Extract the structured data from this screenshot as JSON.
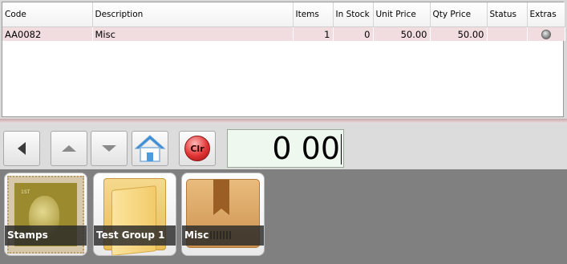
{
  "table": {
    "columns": [
      "Code",
      "Description",
      "Items",
      "In Stock",
      "Unit Price",
      "Qty Price",
      "Status",
      "Extras"
    ],
    "rows": [
      {
        "code": "AA0082",
        "description": "Misc",
        "items": "1",
        "in_stock": "0",
        "unit_price": "50.00",
        "qty_price": "50.00",
        "status": "",
        "extras_icon": "gear-icon"
      }
    ]
  },
  "toolbar": {
    "back_icon": "left-arrow-icon",
    "up_icon": "up-arrow-icon",
    "down_icon": "down-arrow-icon",
    "home_icon": "home-icon",
    "clear_label": "Clr",
    "display_value": "0 00"
  },
  "categories": [
    {
      "label": "Stamps",
      "icon": "stamp-icon"
    },
    {
      "label": "Test Group 1",
      "icon": "folder-icon"
    },
    {
      "label": "Misc",
      "icon": "box-icon"
    }
  ],
  "colors": {
    "selected_row": "#f1dcdf",
    "tile_area": "#808080"
  }
}
